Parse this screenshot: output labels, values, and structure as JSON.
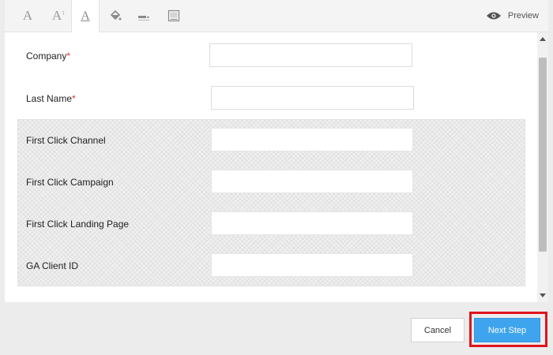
{
  "toolbar": {
    "tools": [
      {
        "name": "font-icon"
      },
      {
        "name": "font-size-icon"
      },
      {
        "name": "font-color-icon"
      },
      {
        "name": "fill-color-icon"
      },
      {
        "name": "line-style-icon"
      },
      {
        "name": "image-icon"
      }
    ],
    "preview_label": "Preview"
  },
  "form": {
    "fields": [
      {
        "label": "Company",
        "required_mark": "*",
        "value": ""
      },
      {
        "label": "Last Name",
        "required_mark": "*",
        "value": ""
      }
    ],
    "hidden_fields": [
      {
        "label": "First Click Channel",
        "value": ""
      },
      {
        "label": "First Click Campaign",
        "value": ""
      },
      {
        "label": "First Click Landing Page",
        "value": ""
      },
      {
        "label": "GA Client ID",
        "value": ""
      }
    ]
  },
  "footer": {
    "cancel_label": "Cancel",
    "next_label": "Next Step"
  },
  "colors": {
    "primary": "#3ea4ee",
    "highlight": "#e0141e",
    "required": "#e0322d"
  }
}
